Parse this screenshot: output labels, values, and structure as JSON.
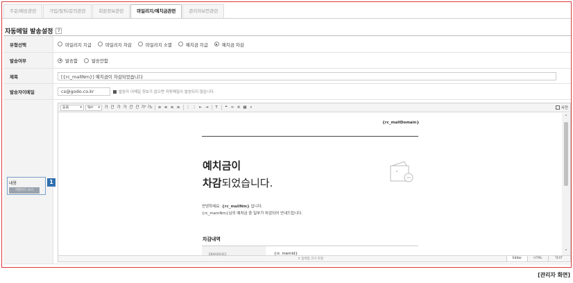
{
  "tabs": [
    {
      "label": "주문/배송관련",
      "active": false
    },
    {
      "label": "가입/탈퇴/문의관련",
      "active": false
    },
    {
      "label": "회원정보관련",
      "active": false
    },
    {
      "label": "마일리지/예치금관련",
      "active": true
    },
    {
      "label": "관리자보안관련",
      "active": false
    }
  ],
  "section_title": "자동메일 발송설정",
  "help_icon_text": "?",
  "form": {
    "type": {
      "label": "유형선택",
      "options": [
        "마일리지 지급",
        "마일리지 차감",
        "마일리지 소멸",
        "예치금 지급",
        "예치금 차감"
      ],
      "selected": "예치금 차감"
    },
    "send": {
      "label": "발송여부",
      "options": [
        "발송함",
        "발송안함"
      ],
      "selected": "발송함"
    },
    "title": {
      "label": "제목",
      "value": "[{rc_mallNm}] 예치금이 차감되었습니다"
    },
    "sender": {
      "label": "발송자이메일",
      "value": "cs@godo.co.kr",
      "note": "발송자 이메일 정보가 없으면 자동메일이 발송되지 않습니다."
    },
    "content": {
      "label": "내용",
      "source_button": "치환코드 보기",
      "step_badge": "1"
    }
  },
  "editor": {
    "font_select": "돋움",
    "size_select": "9pt",
    "toolbar_icons": [
      "bold-icon",
      "underline-icon",
      "italic-icon",
      "strikethrough-icon",
      "font-color-icon",
      "highlight-icon",
      "superscript-icon",
      "subscript-icon",
      "align-left-icon",
      "align-center-icon",
      "align-right-icon",
      "align-justify-icon",
      "ordered-list-icon",
      "unordered-list-icon",
      "outdent-icon",
      "indent-icon",
      "clear-format-icon",
      "quote-icon",
      "link-icon",
      "special-char-icon",
      "table-icon",
      "find-icon"
    ],
    "toolbar_glyphs": [
      "가",
      "간",
      "가",
      "가",
      "간",
      "간",
      "가²",
      "가₂",
      "≡",
      "≡",
      "≡",
      "≡",
      "⋮",
      "⋮",
      "⇤",
      "⇥",
      "T",
      "❝",
      "∞",
      "※",
      "▦",
      "⌕"
    ],
    "fullscreen_label": "사전",
    "doc": {
      "domain": "{rc_mallDomain}",
      "heading_line1": "예치금이",
      "heading_bold": "차감",
      "heading_rest": "되었습니다.",
      "greeting_prefix": "안녕하세요.",
      "greeting_mall": "{rc_mallNm}",
      "greeting_suffix": "입니다.",
      "body_line": "{rc_memNm}님의 예치금 중 일부가 차감되어 안내드립니다.",
      "details_title": "차감내역",
      "table_header": "대상아이디",
      "table_value": "{rc_memId}"
    },
    "resize_text": "⇕ 입력창 크기 조절",
    "modes": [
      {
        "label": "Editor",
        "active": true
      },
      {
        "label": "HTML",
        "active": false
      },
      {
        "label": "TEXT",
        "active": false
      }
    ]
  },
  "caption": "[관리자 화면]",
  "colors": {
    "frame_border": "#d8383d",
    "badge": "#2f6fb0",
    "source_button": "#9aa3ad"
  }
}
